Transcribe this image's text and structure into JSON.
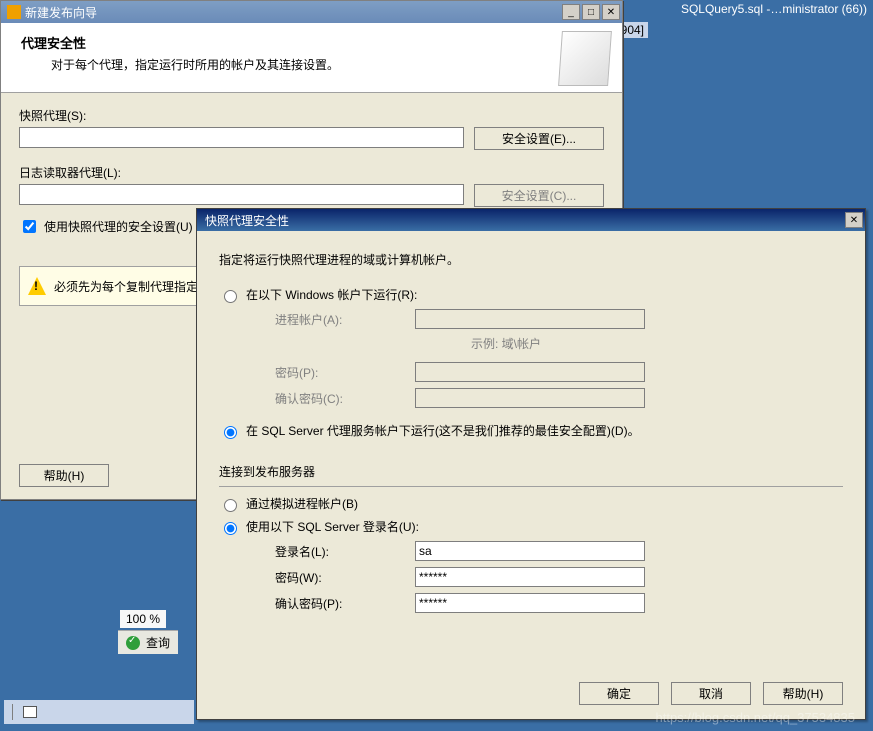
{
  "bg": {
    "tab": "SQLQuery5.sql -…ministrator (66))",
    "num": "904]"
  },
  "wizard": {
    "title": "新建发布向导",
    "heading": "代理安全性",
    "subhead": "对于每个代理，指定运行时所用的帐户及其连接设置。",
    "snap_label": "快照代理(S):",
    "snap_btn": "安全设置(E)...",
    "log_label": "日志读取器代理(L):",
    "log_btn": "安全设置(C)...",
    "use_snap_chk": "使用快照代理的安全设置(U)",
    "warn": "必须先为每个复制代理指定",
    "help": "帮助(H)"
  },
  "zoom": "100 %",
  "status": "查询",
  "dlg": {
    "title": "快照代理安全性",
    "intro": "指定将运行快照代理进程的域或计算机帐户。",
    "r_win": "在以下 Windows 帐户下运行(R):",
    "f_proc": "进程帐户(A):",
    "example": "示例: 域\\帐户",
    "f_pw": "密码(P):",
    "f_pwc": "确认密码(C):",
    "r_sql": "在 SQL Server 代理服务帐户下运行(这不是我们推荐的最佳安全配置)(D)。",
    "section": "连接到发布服务器",
    "r_imp": "通过模拟进程帐户(B)",
    "r_use": "使用以下 SQL Server 登录名(U):",
    "f_login": "登录名(L):",
    "v_login": "sa",
    "f_pw2": "密码(W):",
    "v_pw2": "******",
    "f_pwc2": "确认密码(P):",
    "v_pwc2": "******",
    "ok": "确定",
    "cancel": "取消",
    "help": "帮助(H)"
  },
  "watermark": "https://blog.csdn.net/qq_37534835"
}
